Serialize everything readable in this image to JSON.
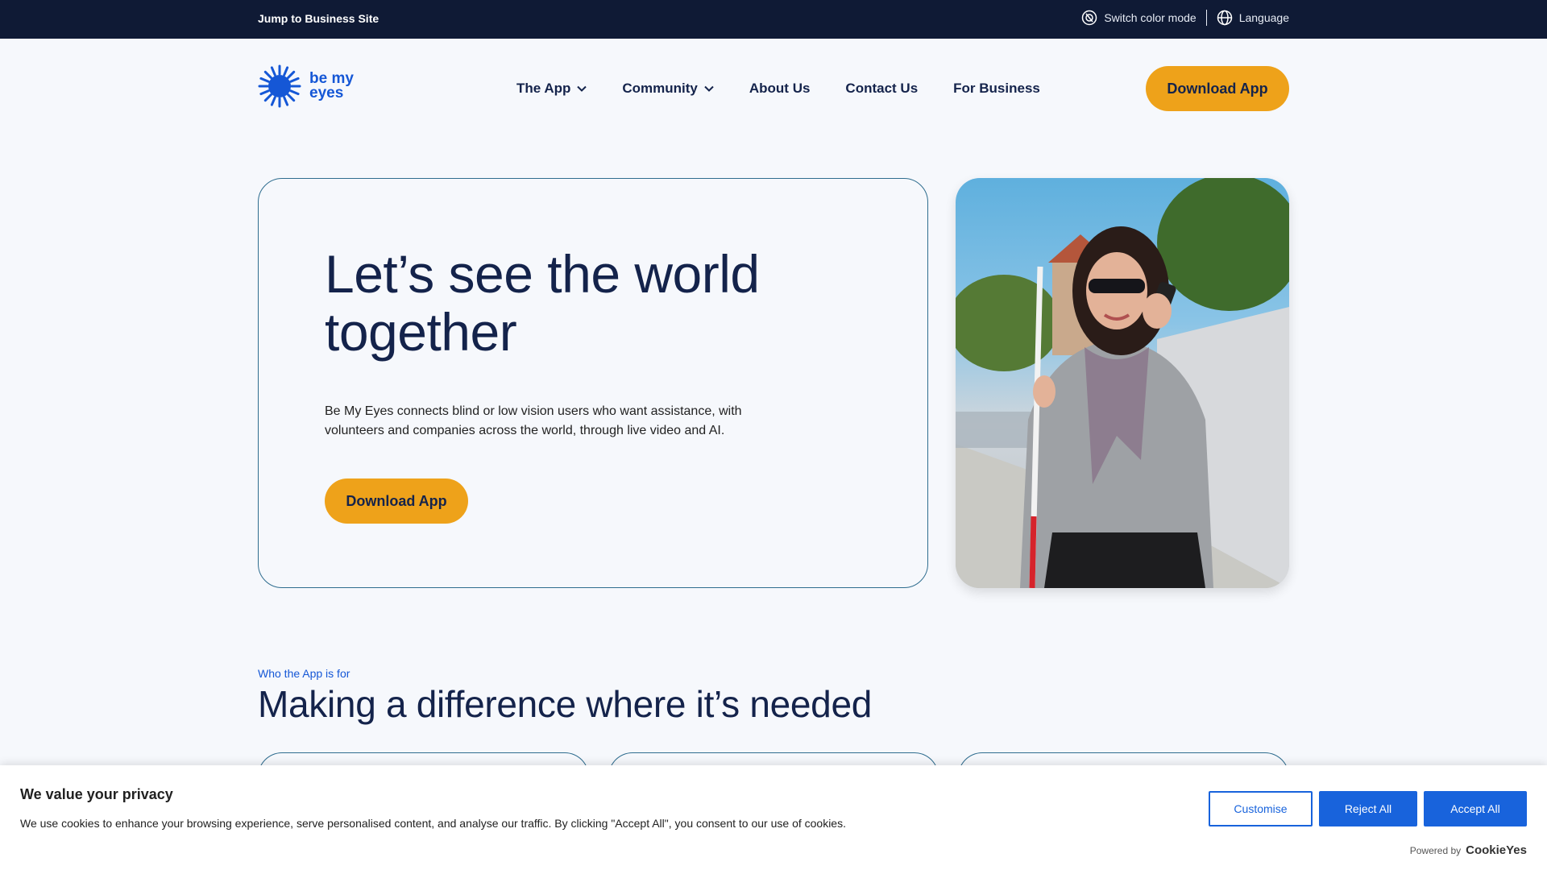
{
  "topbar": {
    "jump_link": "Jump to Business Site",
    "color_mode": "Switch color mode",
    "language": "Language"
  },
  "header": {
    "logo_line1": "be my",
    "logo_line2": "eyes",
    "nav": [
      "The App",
      "Community",
      "About Us",
      "Contact Us",
      "For Business"
    ],
    "download_label": "Download App"
  },
  "hero": {
    "title": "Let’s see the world together",
    "description": "Be My Eyes connects blind or low vision users who want assistance, with volunteers and companies across the world, through live video and AI.",
    "download_label": "Download App"
  },
  "section": {
    "eyebrow": "Who the App is for",
    "title": "Making a difference where it’s needed"
  },
  "cookie": {
    "title": "We value your privacy",
    "text": "We use cookies to enhance your browsing experience, serve personalised content, and analyse our traffic. By clicking \"Accept All\", you consent to our use of cookies.",
    "customise": "Customise",
    "reject": "Reject All",
    "accept": "Accept All",
    "powered_by": "Powered by",
    "brand": "CookieYes"
  },
  "colors": {
    "accent": "#eea21a",
    "brand_blue": "#1557d6",
    "topbar": "#0f1a35",
    "cookie_blue": "#1863dc"
  }
}
